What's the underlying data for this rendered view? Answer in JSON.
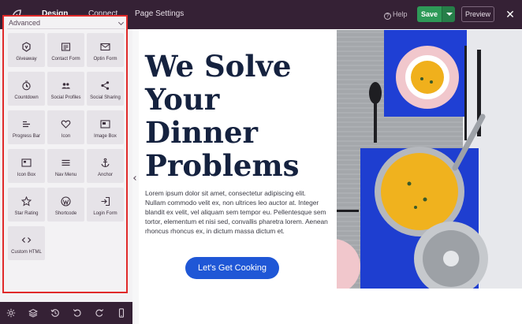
{
  "topbar": {
    "tabs": [
      {
        "label": "Design",
        "active": true
      },
      {
        "label": "Connect",
        "active": false
      },
      {
        "label": "Page Settings",
        "active": false
      }
    ],
    "help_label": "Help",
    "save_label": "Save",
    "preview_label": "Preview",
    "colors": {
      "background": "#352135",
      "save": "#2e9a58"
    }
  },
  "sidebar": {
    "section_title": "Advanced",
    "blocks": [
      {
        "label": "Giveaway",
        "icon": "giveaway-icon"
      },
      {
        "label": "Contact Form",
        "icon": "contact-form-icon"
      },
      {
        "label": "Optin Form",
        "icon": "optin-form-icon"
      },
      {
        "label": "Countdown",
        "icon": "countdown-icon"
      },
      {
        "label": "Social Profiles",
        "icon": "social-profiles-icon"
      },
      {
        "label": "Social Sharing",
        "icon": "social-sharing-icon"
      },
      {
        "label": "Progress Bar",
        "icon": "progress-bar-icon"
      },
      {
        "label": "Icon",
        "icon": "heart-icon"
      },
      {
        "label": "Image Box",
        "icon": "image-box-icon"
      },
      {
        "label": "Icon Box",
        "icon": "icon-box-icon"
      },
      {
        "label": "Nav Menu",
        "icon": "nav-menu-icon"
      },
      {
        "label": "Anchor",
        "icon": "anchor-icon"
      },
      {
        "label": "Star Rating",
        "icon": "star-icon"
      },
      {
        "label": "Shortcode",
        "icon": "wordpress-icon"
      },
      {
        "label": "Login Form",
        "icon": "login-icon"
      },
      {
        "label": "Custom HTML",
        "icon": "code-icon"
      }
    ]
  },
  "bottombar": {
    "icons": [
      "settings-icon",
      "layers-icon",
      "history-icon",
      "undo-icon",
      "redo-icon",
      "mobile-preview-icon"
    ]
  },
  "page": {
    "headline": "We Solve Your Dinner Problems",
    "body": "Lorem ipsum dolor sit amet, consectetur adipiscing elit. Nullam commodo velit ex, non ultrices leo auctor at. Integer blandit ex velit, vel aliquam sem tempor eu. Pellentesque sem tortor, elementum et nisi sed, convallis pharetra lorem. Aenean rhoncus rhoncus ex, in dictum massa dictum et.",
    "cta_label": "Let's Get Cooking",
    "colors": {
      "headline": "#15223f",
      "cta": "#1f57d6"
    }
  }
}
